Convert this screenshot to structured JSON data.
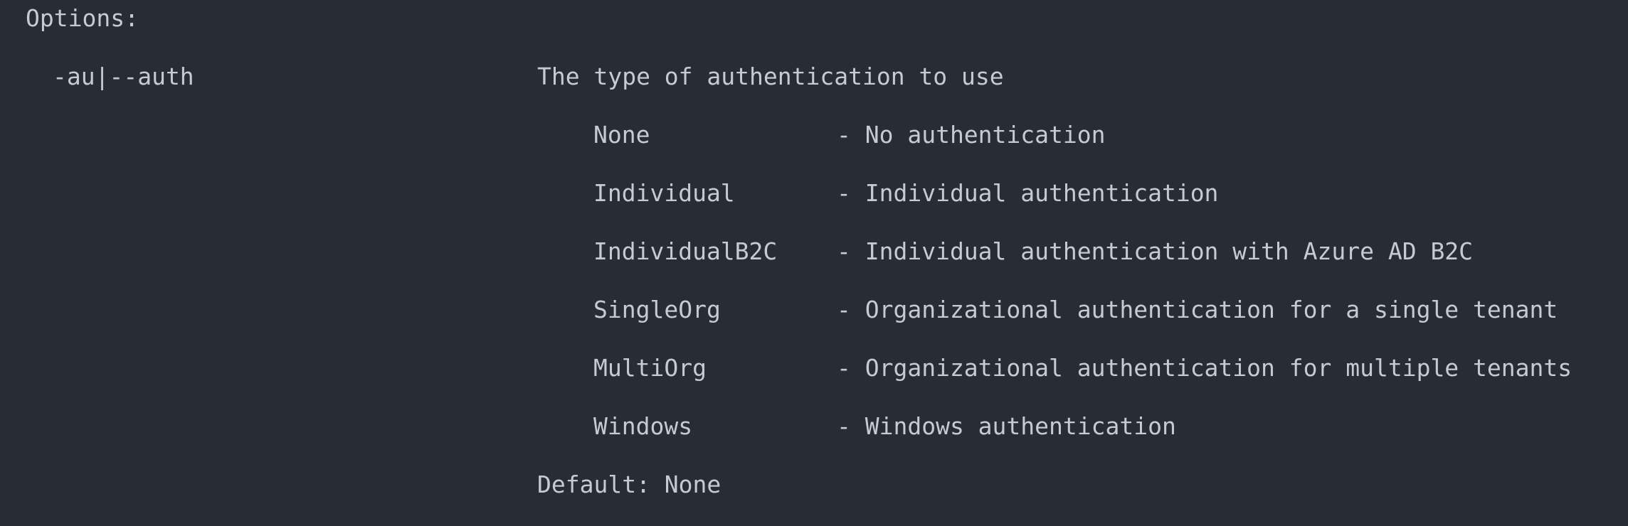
{
  "terminal": {
    "heading": "Options:",
    "option": {
      "flag": "-au|--auth",
      "description": "The type of authentication to use",
      "values": [
        {
          "name": "None",
          "description": "- No authentication"
        },
        {
          "name": "Individual",
          "description": "- Individual authentication"
        },
        {
          "name": "IndividualB2C",
          "description": "- Individual authentication with Azure AD B2C"
        },
        {
          "name": "SingleOrg",
          "description": "- Organizational authentication for a single tenant"
        },
        {
          "name": "MultiOrg",
          "description": "- Organizational authentication for multiple tenants"
        },
        {
          "name": "Windows",
          "description": "- Windows authentication"
        }
      ],
      "default": "Default: None"
    }
  }
}
